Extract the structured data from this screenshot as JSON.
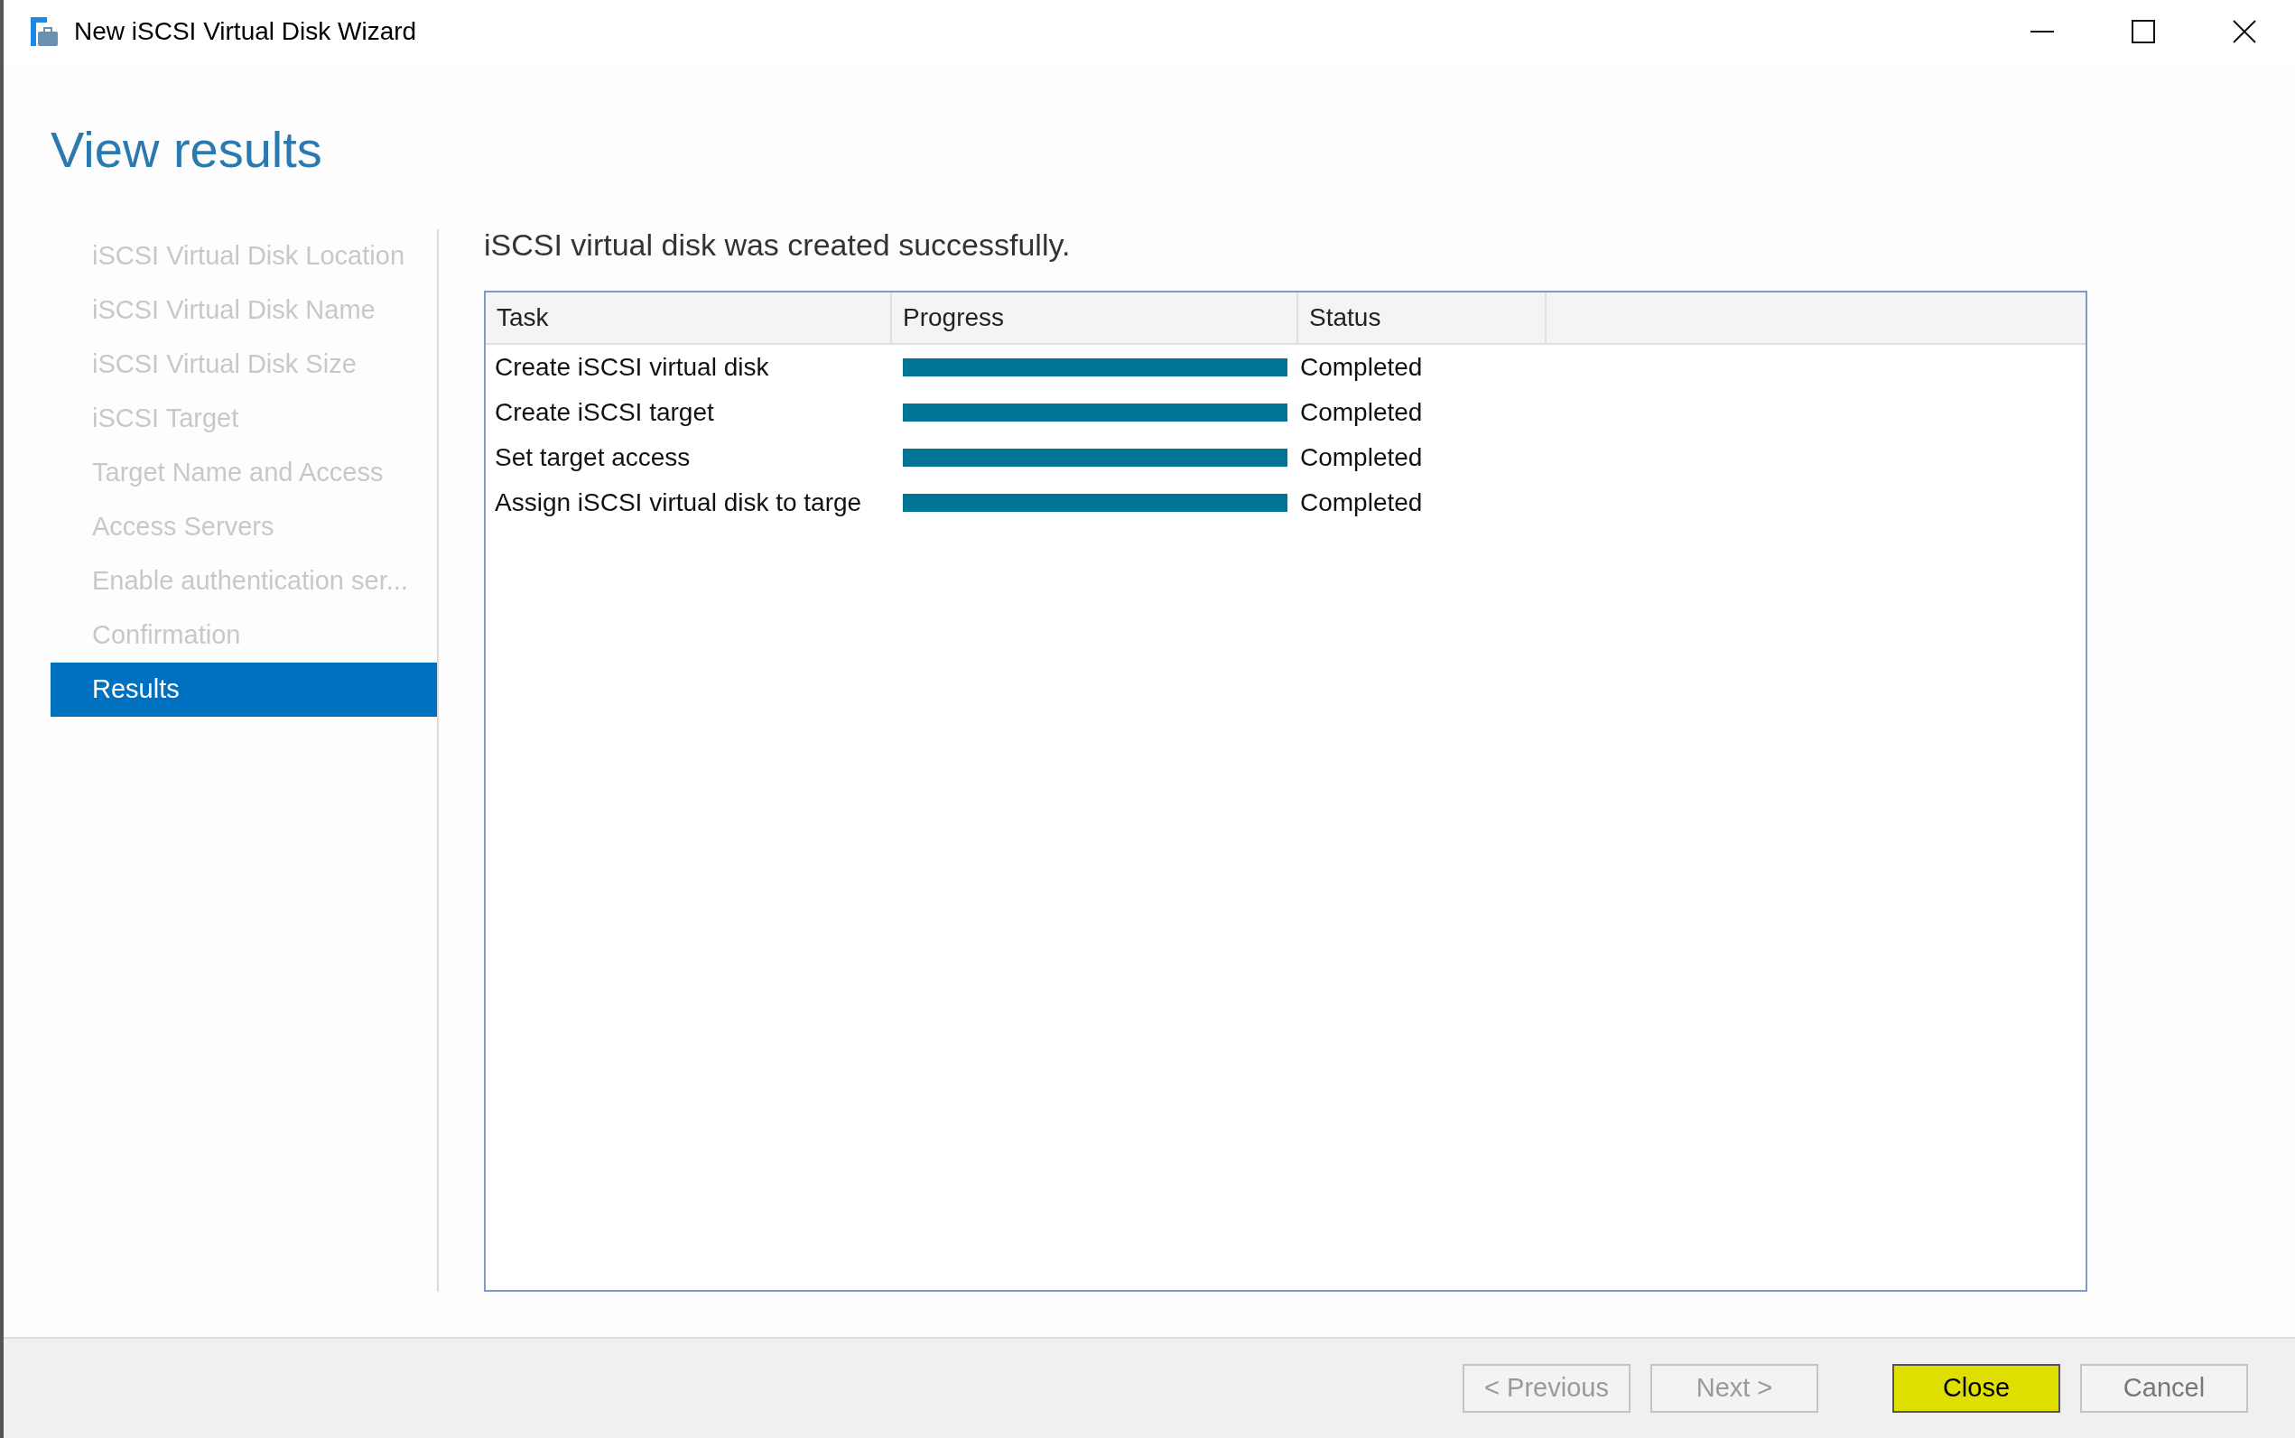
{
  "window": {
    "title": "New iSCSI Virtual Disk Wizard"
  },
  "page_title": "View results",
  "sidebar": {
    "items": [
      {
        "label": "iSCSI Virtual Disk Location",
        "selected": false,
        "disabled": true
      },
      {
        "label": "iSCSI Virtual Disk Name",
        "selected": false,
        "disabled": true
      },
      {
        "label": "iSCSI Virtual Disk Size",
        "selected": false,
        "disabled": true
      },
      {
        "label": "iSCSI Target",
        "selected": false,
        "disabled": true
      },
      {
        "label": "Target Name and Access",
        "selected": false,
        "disabled": true
      },
      {
        "label": "Access Servers",
        "selected": false,
        "disabled": true
      },
      {
        "label": "Enable authentication ser...",
        "selected": false,
        "disabled": true
      },
      {
        "label": "Confirmation",
        "selected": false,
        "disabled": true
      },
      {
        "label": "Results",
        "selected": true,
        "disabled": false
      }
    ]
  },
  "message": "iSCSI virtual disk was created successfully.",
  "table": {
    "columns": [
      "Task",
      "Progress",
      "Status"
    ],
    "rows": [
      {
        "task": "Create iSCSI virtual disk",
        "level": 1,
        "status": "Completed"
      },
      {
        "task": "Create iSCSI target",
        "level": 1,
        "status": "Completed"
      },
      {
        "task": "Set target access",
        "level": 1,
        "status": "Completed"
      },
      {
        "task": "Assign iSCSI virtual disk to targe",
        "level": 1,
        "status": "Completed"
      }
    ]
  },
  "buttons": [
    {
      "label": "< Previous",
      "disabled": true,
      "highlighted": false
    },
    {
      "label": "Next >",
      "disabled": true,
      "highlighted": false
    },
    {
      "label": "Close",
      "disabled": false,
      "highlighted": true
    },
    {
      "label": "Cancel",
      "disabled": false,
      "highlighted": false
    }
  ]
}
